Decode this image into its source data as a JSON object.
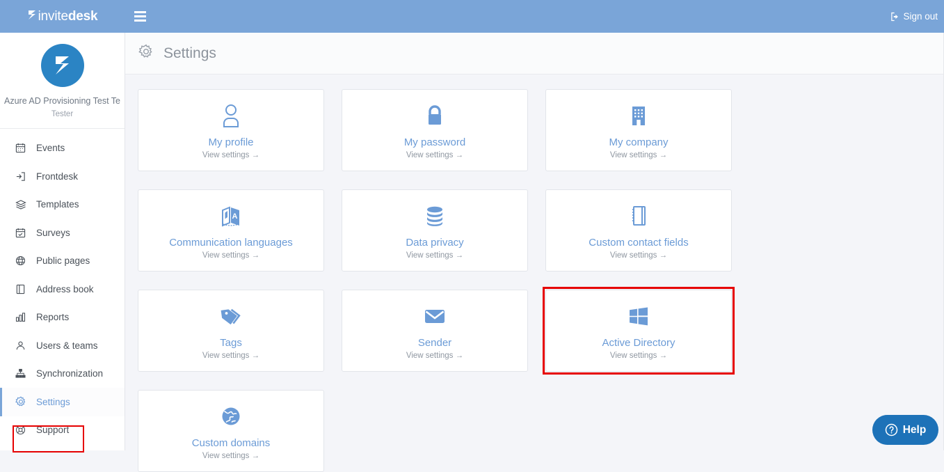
{
  "topbar": {
    "brand_prefix": "invite",
    "brand_suffix": "desk",
    "menu_icon": "hamburger-icon",
    "signout_label": "Sign out",
    "signout_icon": "sign-out-icon",
    "background_color": "#7aa5d8"
  },
  "sidebar": {
    "org_name": "Azure AD Provisioning Test Team",
    "org_role": "Tester",
    "avatar_icon": "invitedesk-logo-mark",
    "accent_color": "#6b9bd6",
    "items": [
      {
        "label": "Events",
        "icon": "calendar-icon",
        "active": false
      },
      {
        "label": "Frontdesk",
        "icon": "login-arrow-icon",
        "active": false
      },
      {
        "label": "Templates",
        "icon": "layers-icon",
        "active": false
      },
      {
        "label": "Surveys",
        "icon": "calendar-check-icon",
        "active": false
      },
      {
        "label": "Public pages",
        "icon": "globe-icon",
        "active": false
      },
      {
        "label": "Address book",
        "icon": "book-icon",
        "active": false
      },
      {
        "label": "Reports",
        "icon": "bar-chart-icon",
        "active": false
      },
      {
        "label": "Users & teams",
        "icon": "users-icon",
        "active": false
      },
      {
        "label": "Synchronization",
        "icon": "sitemap-icon",
        "active": false
      },
      {
        "label": "Settings",
        "icon": "gear-icon",
        "active": true
      },
      {
        "label": "Support",
        "icon": "lifebuoy-icon",
        "active": false
      }
    ]
  },
  "page": {
    "title": "Settings",
    "title_icon": "gear-icon",
    "background_color": "#f4f5f9"
  },
  "cards": [
    {
      "title": "My profile",
      "sub": "View settings →",
      "icon": "user-icon",
      "highlighted": false
    },
    {
      "title": "My password",
      "sub": "View settings →",
      "icon": "lock-icon",
      "highlighted": false
    },
    {
      "title": "My company",
      "sub": "View settings →",
      "icon": "building-icon",
      "highlighted": false
    },
    {
      "title": "Communication languages",
      "sub": "View settings →",
      "icon": "translate-icon",
      "highlighted": false
    },
    {
      "title": "Data privacy",
      "sub": "View settings →",
      "icon": "database-icon",
      "highlighted": false
    },
    {
      "title": "Custom contact fields",
      "sub": "View settings →",
      "icon": "notebook-icon",
      "highlighted": false
    },
    {
      "title": "Tags",
      "sub": "View settings →",
      "icon": "tags-icon",
      "highlighted": false
    },
    {
      "title": "Sender",
      "sub": "View settings →",
      "icon": "envelope-icon",
      "highlighted": false
    },
    {
      "title": "Active Directory",
      "sub": "View settings →",
      "icon": "windows-icon",
      "highlighted": true
    },
    {
      "title": "Custom domains",
      "sub": "View settings →",
      "icon": "globe-solid-icon",
      "highlighted": false
    }
  ],
  "help": {
    "label": "Help",
    "icon": "question-circle-icon",
    "background_color": "#1d72b8"
  },
  "highlight_color": "#e60000"
}
